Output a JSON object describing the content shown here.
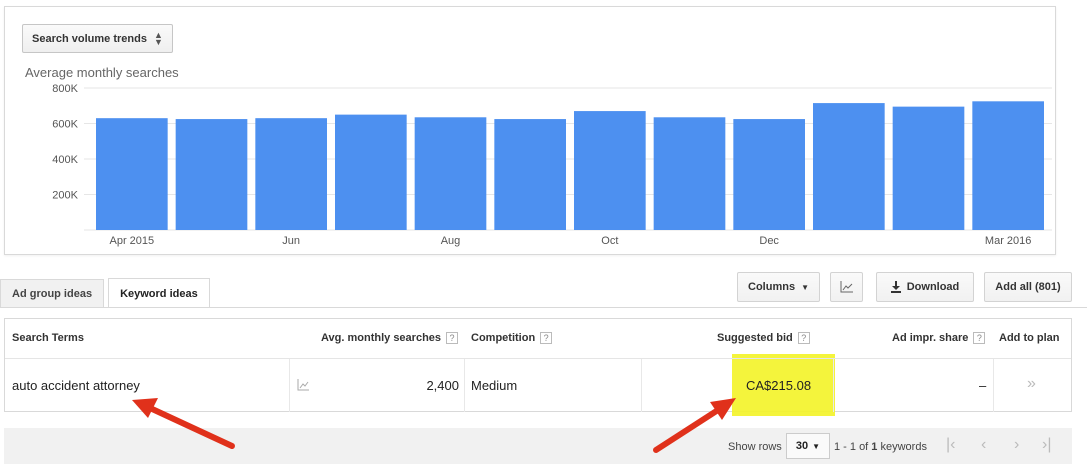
{
  "trend_selector": {
    "label": "Search volume trends"
  },
  "chart_data": {
    "type": "bar",
    "title": "Average monthly searches",
    "categories": [
      "Apr 2015",
      "May",
      "Jun",
      "Jul",
      "Aug",
      "Sep",
      "Oct",
      "Nov",
      "Dec",
      "Jan",
      "Feb",
      "Mar 2016"
    ],
    "x_tick_labels": [
      "Apr 2015",
      "",
      "Jun",
      "",
      "Aug",
      "",
      "Oct",
      "",
      "Dec",
      "",
      "",
      "Mar 2016"
    ],
    "values": [
      630000,
      625000,
      630000,
      650000,
      635000,
      625000,
      670000,
      635000,
      625000,
      715000,
      695000,
      725000
    ],
    "ylim": [
      0,
      800000
    ],
    "y_ticks": [
      200000,
      400000,
      600000,
      800000
    ],
    "y_tick_labels": [
      "200K",
      "400K",
      "600K",
      "800K"
    ],
    "bar_color": "#4d90f0",
    "grid": true
  },
  "tabs": [
    {
      "label": "Ad group ideas",
      "active": false
    },
    {
      "label": "Keyword ideas",
      "active": true
    }
  ],
  "toolbar": {
    "columns_label": "Columns",
    "download_label": "Download",
    "add_all_label": "Add all (801)"
  },
  "table": {
    "headers": {
      "search_terms": "Search Terms",
      "avg_monthly": "Avg. monthly searches",
      "competition": "Competition",
      "suggested_bid": "Suggested bid",
      "ad_impr_share": "Ad impr. share",
      "add_to_plan": "Add to plan"
    },
    "help_glyph": "?",
    "rows": [
      {
        "keyword": "auto accident attorney",
        "avg_monthly": "2,400",
        "competition": "Medium",
        "suggested_bid": "CA$215.08",
        "ad_impr_share": "–",
        "add_glyph": "»"
      }
    ]
  },
  "footer": {
    "show_rows_label": "Show rows",
    "rows_value": "30",
    "range_prefix": "1 - 1 of ",
    "range_count": "1",
    "range_suffix": " keywords"
  },
  "colors": {
    "highlight": "#f3f32b",
    "arrow": "#e0311b",
    "bar": "#4d90f0"
  }
}
